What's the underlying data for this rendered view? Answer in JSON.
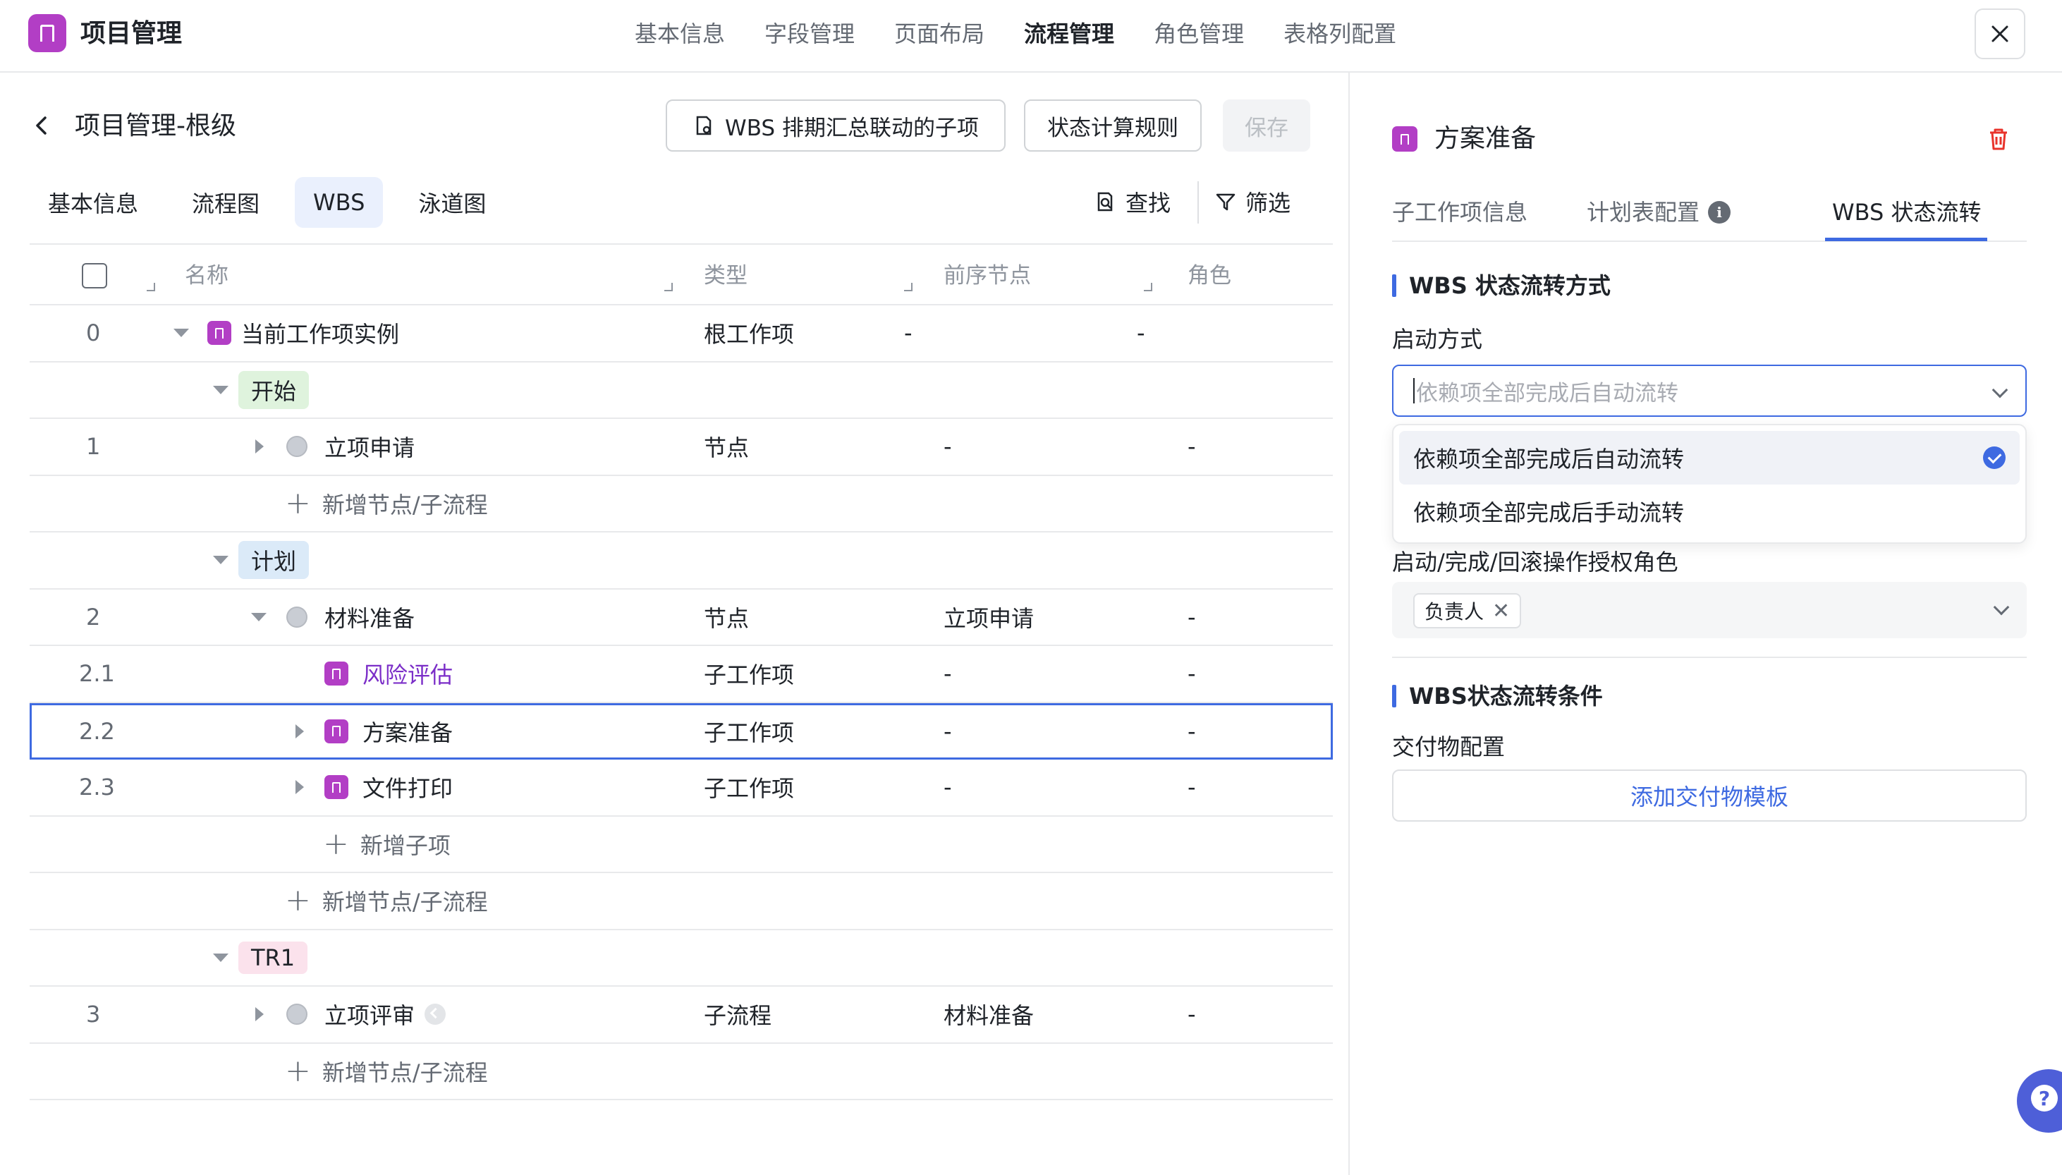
{
  "header": {
    "app_title": "项目管理",
    "nav": [
      "基本信息",
      "字段管理",
      "页面布局",
      "流程管理",
      "角色管理",
      "表格列配置"
    ],
    "active_nav": "流程管理"
  },
  "left": {
    "page_title": "项目管理-根级",
    "btn_wbs": "WBS 排期汇总联动的子项",
    "btn_rule": "状态计算规则",
    "btn_save": "保存",
    "tabs": [
      "基本信息",
      "流程图",
      "WBS",
      "泳道图"
    ],
    "active_tab": "WBS",
    "find": "查找",
    "filter": "筛选",
    "columns": [
      "名称",
      "类型",
      "前序节点",
      "角色"
    ],
    "rows": [
      {
        "idx": "0",
        "name": "当前工作项实例",
        "type": "根工作项",
        "pre": "-",
        "role": "-"
      },
      {
        "stage": "开始"
      },
      {
        "idx": "1",
        "name": "立项申请",
        "type": "节点",
        "pre": "-",
        "role": "-"
      },
      {
        "add": "新增节点/子流程"
      },
      {
        "stage": "计划"
      },
      {
        "idx": "2",
        "name": "材料准备",
        "type": "节点",
        "pre": "立项申请",
        "role": "-"
      },
      {
        "idx": "2.1",
        "name": "风险评估",
        "type": "子工作项",
        "pre": "-",
        "role": "-"
      },
      {
        "idx": "2.2",
        "name": "方案准备",
        "type": "子工作项",
        "pre": "-",
        "role": "-"
      },
      {
        "idx": "2.3",
        "name": "文件打印",
        "type": "子工作项",
        "pre": "-",
        "role": "-"
      },
      {
        "add": "新增子项"
      },
      {
        "add": "新增节点/子流程"
      },
      {
        "stage": "TR1"
      },
      {
        "idx": "3",
        "name": "立项评审",
        "type": "子流程",
        "pre": "材料准备",
        "role": "-"
      },
      {
        "add": "新增节点/子流程"
      }
    ]
  },
  "right": {
    "title": "方案准备",
    "tabs": [
      "子工作项信息",
      "计划表配置",
      "WBS 状态流转"
    ],
    "active_tab": "WBS 状态流转",
    "section1": "WBS 状态流转方式",
    "start_label": "启动方式",
    "start_placeholder": "依赖项全部完成后自动流转",
    "options": [
      "依赖项全部完成后自动流转",
      "依赖项全部完成后手动流转"
    ],
    "role_label": "启动/完成/回滚操作授权角色",
    "role_chip": "负责人",
    "section2": "WBS状态流转条件",
    "deliverable_label": "交付物配置",
    "add_template": "添加交付物模板"
  },
  "colors": {
    "accent": "#3e6ae1",
    "brand": "#b23ec5",
    "link_purple": "#7b2ec8"
  }
}
